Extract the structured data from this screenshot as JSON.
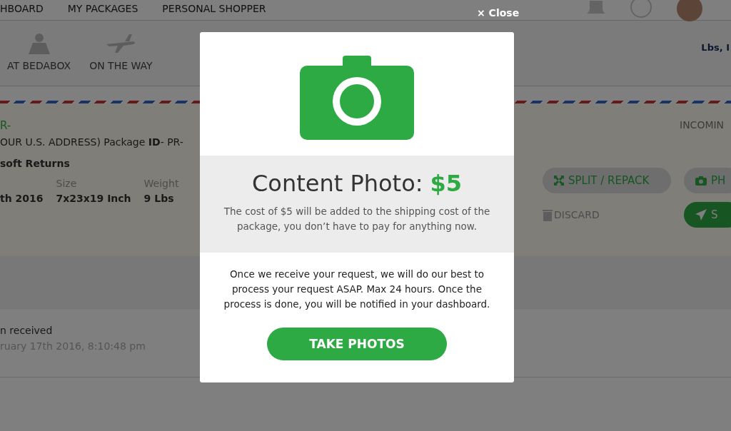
{
  "nav": {
    "items": [
      "HBOARD",
      "MY PACKAGES",
      "PERSONAL SHOPPER"
    ]
  },
  "tabs": [
    {
      "label": "AT BEDABOX"
    },
    {
      "label": "ON THE WAY"
    }
  ],
  "units": "Lbs, I",
  "package": {
    "id_prefix": "R-",
    "address_line": "OUR U.S. ADDRESS) Package **ID**- PR-",
    "sender": "soft Returns",
    "status": "INCOMIN",
    "fields": [
      {
        "value": "th 2016"
      },
      {
        "label": "Size",
        "value": "7x23x19 Inch"
      },
      {
        "label": "Weight",
        "value": "9 Lbs"
      }
    ],
    "actions": [
      {
        "kind": "split",
        "label": "SPLIT / REPACK"
      },
      {
        "kind": "photo",
        "label": "PH"
      },
      {
        "kind": "discard",
        "label": "DISCARD"
      },
      {
        "kind": "send",
        "label": "S"
      }
    ]
  },
  "log": {
    "event": "n received",
    "time": "ruary 17th 2016, 8:10:48 pm"
  },
  "modal": {
    "close": "× Close",
    "title": "Content Photo:",
    "price": "$5",
    "note": "The cost of $5 will be added to the shipping cost of the package, you don’t have to pay for anything now.",
    "body": "Once we receive your request, we will do our best to process your request ASAP. Max 24 hours. Once the process is done, you will be notified in your dashboard.",
    "button": "TAKE PHOTOS"
  }
}
